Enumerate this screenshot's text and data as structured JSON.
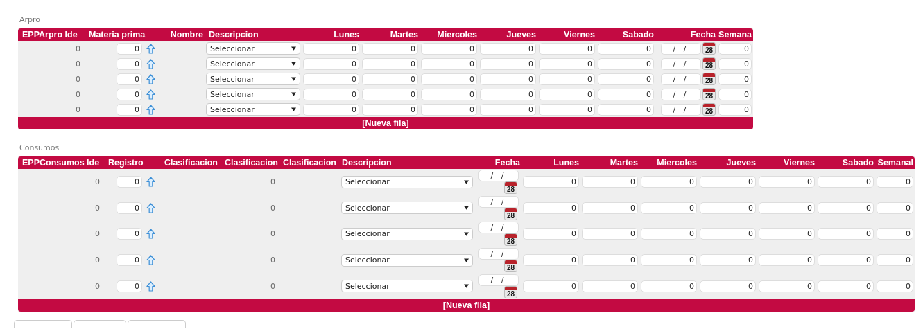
{
  "sections": [
    {
      "title": "Arpro",
      "columns": [
        "EPPArpro Ide",
        "Materia prima",
        "Nombre",
        "Descripcion",
        "Lunes",
        "Martes",
        "Miercoles",
        "Jueves",
        "Viernes",
        "Sabado",
        "Fecha",
        "Semana"
      ],
      "rows": [
        {
          "cells": [
            {
              "kind": "text",
              "value": "0"
            },
            {
              "kind": "lookup",
              "value": "0"
            },
            {
              "kind": "empty"
            },
            {
              "kind": "select",
              "value": "Seleccionar"
            },
            {
              "kind": "number",
              "value": "0"
            },
            {
              "kind": "number",
              "value": "0"
            },
            {
              "kind": "number",
              "value": "0"
            },
            {
              "kind": "number",
              "value": "0"
            },
            {
              "kind": "number",
              "value": "0"
            },
            {
              "kind": "number",
              "value": "0"
            },
            {
              "kind": "date",
              "value": "/ /",
              "icon_text": "28"
            },
            {
              "kind": "number",
              "value": "0"
            }
          ]
        },
        {
          "cells": [
            {
              "kind": "text",
              "value": "0"
            },
            {
              "kind": "lookup",
              "value": "0"
            },
            {
              "kind": "empty"
            },
            {
              "kind": "select",
              "value": "Seleccionar"
            },
            {
              "kind": "number",
              "value": "0"
            },
            {
              "kind": "number",
              "value": "0"
            },
            {
              "kind": "number",
              "value": "0"
            },
            {
              "kind": "number",
              "value": "0"
            },
            {
              "kind": "number",
              "value": "0"
            },
            {
              "kind": "number",
              "value": "0"
            },
            {
              "kind": "date",
              "value": "/ /",
              "icon_text": "28"
            },
            {
              "kind": "number",
              "value": "0"
            }
          ]
        },
        {
          "cells": [
            {
              "kind": "text",
              "value": "0"
            },
            {
              "kind": "lookup",
              "value": "0"
            },
            {
              "kind": "empty"
            },
            {
              "kind": "select",
              "value": "Seleccionar"
            },
            {
              "kind": "number",
              "value": "0"
            },
            {
              "kind": "number",
              "value": "0"
            },
            {
              "kind": "number",
              "value": "0"
            },
            {
              "kind": "number",
              "value": "0"
            },
            {
              "kind": "number",
              "value": "0"
            },
            {
              "kind": "number",
              "value": "0"
            },
            {
              "kind": "date",
              "value": "/ /",
              "icon_text": "28"
            },
            {
              "kind": "number",
              "value": "0"
            }
          ]
        },
        {
          "cells": [
            {
              "kind": "text",
              "value": "0"
            },
            {
              "kind": "lookup",
              "value": "0"
            },
            {
              "kind": "empty"
            },
            {
              "kind": "select",
              "value": "Seleccionar"
            },
            {
              "kind": "number",
              "value": "0"
            },
            {
              "kind": "number",
              "value": "0"
            },
            {
              "kind": "number",
              "value": "0"
            },
            {
              "kind": "number",
              "value": "0"
            },
            {
              "kind": "number",
              "value": "0"
            },
            {
              "kind": "number",
              "value": "0"
            },
            {
              "kind": "date",
              "value": "/ /",
              "icon_text": "28"
            },
            {
              "kind": "number",
              "value": "0"
            }
          ]
        },
        {
          "cells": [
            {
              "kind": "text",
              "value": "0"
            },
            {
              "kind": "lookup",
              "value": "0"
            },
            {
              "kind": "empty"
            },
            {
              "kind": "select",
              "value": "Seleccionar"
            },
            {
              "kind": "number",
              "value": "0"
            },
            {
              "kind": "number",
              "value": "0"
            },
            {
              "kind": "number",
              "value": "0"
            },
            {
              "kind": "number",
              "value": "0"
            },
            {
              "kind": "number",
              "value": "0"
            },
            {
              "kind": "number",
              "value": "0"
            },
            {
              "kind": "date",
              "value": "/ /",
              "icon_text": "28"
            },
            {
              "kind": "number",
              "value": "0"
            }
          ]
        }
      ],
      "footer": "[Nueva fila]"
    },
    {
      "title": "Consumos",
      "columns": [
        "EPPConsumos Ide",
        "Registro",
        "Clasificacion",
        "Clasificacion",
        "Clasificacion",
        "Descripcion",
        "Fecha",
        "Lunes",
        "Martes",
        "Miercoles",
        "Jueves",
        "Viernes",
        "Sabado",
        "Semanal"
      ],
      "rows": [
        {
          "cells": [
            {
              "kind": "text",
              "value": "0"
            },
            {
              "kind": "lookup",
              "value": "0"
            },
            {
              "kind": "empty"
            },
            {
              "kind": "text",
              "value": "0"
            },
            {
              "kind": "empty"
            },
            {
              "kind": "select",
              "value": "Seleccionar"
            },
            {
              "kind": "date",
              "value": "/ /",
              "icon_text": "28"
            },
            {
              "kind": "number",
              "value": "0"
            },
            {
              "kind": "number",
              "value": "0"
            },
            {
              "kind": "number",
              "value": "0"
            },
            {
              "kind": "number",
              "value": "0"
            },
            {
              "kind": "number",
              "value": "0"
            },
            {
              "kind": "number",
              "value": "0"
            },
            {
              "kind": "number",
              "value": "0"
            }
          ]
        },
        {
          "cells": [
            {
              "kind": "text",
              "value": "0"
            },
            {
              "kind": "lookup",
              "value": "0"
            },
            {
              "kind": "empty"
            },
            {
              "kind": "text",
              "value": "0"
            },
            {
              "kind": "empty"
            },
            {
              "kind": "select",
              "value": "Seleccionar"
            },
            {
              "kind": "date",
              "value": "/ /",
              "icon_text": "28"
            },
            {
              "kind": "number",
              "value": "0"
            },
            {
              "kind": "number",
              "value": "0"
            },
            {
              "kind": "number",
              "value": "0"
            },
            {
              "kind": "number",
              "value": "0"
            },
            {
              "kind": "number",
              "value": "0"
            },
            {
              "kind": "number",
              "value": "0"
            },
            {
              "kind": "number",
              "value": "0"
            }
          ]
        },
        {
          "cells": [
            {
              "kind": "text",
              "value": "0"
            },
            {
              "kind": "lookup",
              "value": "0"
            },
            {
              "kind": "empty"
            },
            {
              "kind": "text",
              "value": "0"
            },
            {
              "kind": "empty"
            },
            {
              "kind": "select",
              "value": "Seleccionar"
            },
            {
              "kind": "date",
              "value": "/ /",
              "icon_text": "28"
            },
            {
              "kind": "number",
              "value": "0"
            },
            {
              "kind": "number",
              "value": "0"
            },
            {
              "kind": "number",
              "value": "0"
            },
            {
              "kind": "number",
              "value": "0"
            },
            {
              "kind": "number",
              "value": "0"
            },
            {
              "kind": "number",
              "value": "0"
            },
            {
              "kind": "number",
              "value": "0"
            }
          ]
        },
        {
          "cells": [
            {
              "kind": "text",
              "value": "0"
            },
            {
              "kind": "lookup",
              "value": "0"
            },
            {
              "kind": "empty"
            },
            {
              "kind": "text",
              "value": "0"
            },
            {
              "kind": "empty"
            },
            {
              "kind": "select",
              "value": "Seleccionar"
            },
            {
              "kind": "date",
              "value": "/ /",
              "icon_text": "28"
            },
            {
              "kind": "number",
              "value": "0"
            },
            {
              "kind": "number",
              "value": "0"
            },
            {
              "kind": "number",
              "value": "0"
            },
            {
              "kind": "number",
              "value": "0"
            },
            {
              "kind": "number",
              "value": "0"
            },
            {
              "kind": "number",
              "value": "0"
            },
            {
              "kind": "number",
              "value": "0"
            }
          ]
        },
        {
          "cells": [
            {
              "kind": "text",
              "value": "0"
            },
            {
              "kind": "lookup",
              "value": "0"
            },
            {
              "kind": "empty"
            },
            {
              "kind": "text",
              "value": "0"
            },
            {
              "kind": "empty"
            },
            {
              "kind": "select",
              "value": "Seleccionar"
            },
            {
              "kind": "date",
              "value": "/ /",
              "icon_text": "28"
            },
            {
              "kind": "number",
              "value": "0"
            },
            {
              "kind": "number",
              "value": "0"
            },
            {
              "kind": "number",
              "value": "0"
            },
            {
              "kind": "number",
              "value": "0"
            },
            {
              "kind": "number",
              "value": "0"
            },
            {
              "kind": "number",
              "value": "0"
            },
            {
              "kind": "number",
              "value": "0"
            }
          ]
        }
      ],
      "footer": "[Nueva fila]"
    }
  ],
  "footer_buttons": [
    {
      "kind": "button"
    },
    {
      "kind": "button"
    },
    {
      "kind": "button"
    }
  ]
}
